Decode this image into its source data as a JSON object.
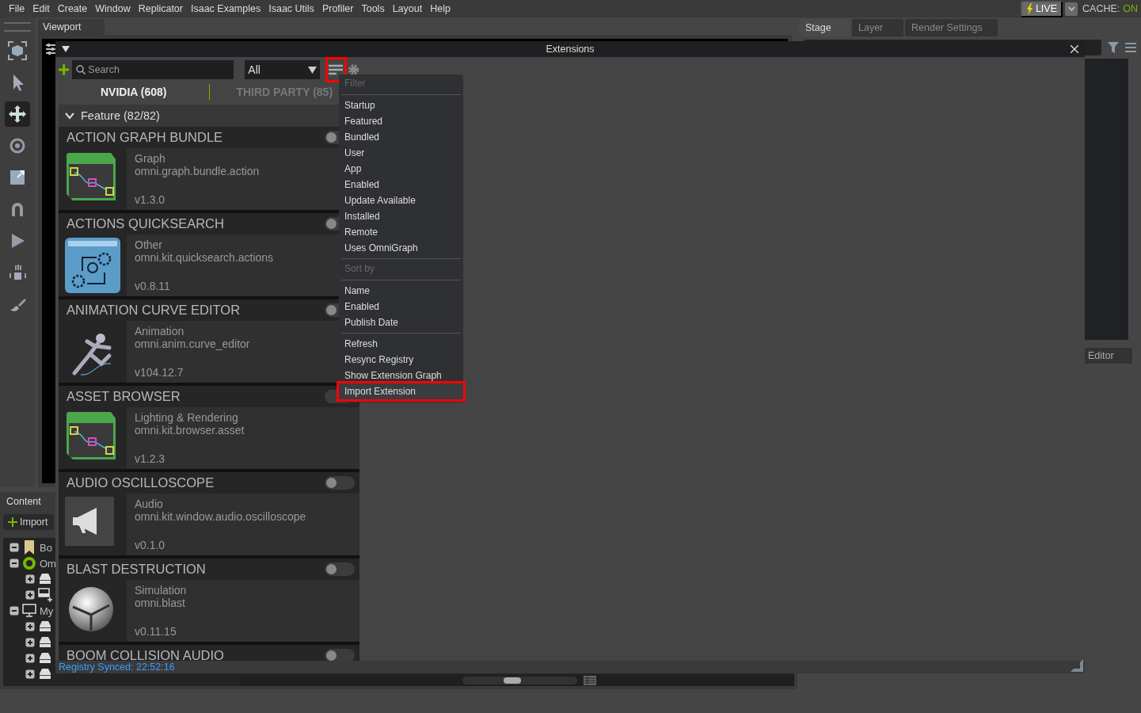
{
  "menu_bar": {
    "items": [
      "File",
      "Edit",
      "Create",
      "Window",
      "Replicator",
      "Isaac Examples",
      "Isaac Utils",
      "Profiler",
      "Tools",
      "Layout",
      "Help"
    ]
  },
  "live": {
    "label": "LIVE",
    "on": true
  },
  "cache": {
    "label": "CACHE:",
    "value": "ON",
    "on": true
  },
  "viewport": {
    "tab": "Viewport"
  },
  "toolbar": [
    {
      "kind": "select",
      "selected": false
    },
    {
      "kind": "pointer",
      "selected": false
    },
    {
      "kind": "move",
      "selected": true
    },
    {
      "kind": "rotate",
      "selected": false
    },
    {
      "kind": "scale",
      "selected": false
    },
    {
      "kind": "snap",
      "selected": false
    },
    {
      "kind": "play",
      "selected": false
    },
    {
      "kind": "drop",
      "selected": false
    },
    {
      "kind": "paint",
      "selected": false
    }
  ],
  "content": {
    "tab": "Content",
    "import_button": "Import",
    "tree": [
      {
        "label": "Bo",
        "kind": "bookmark",
        "expanded": true
      },
      {
        "label": "Om",
        "kind": "omniverse",
        "expanded": true,
        "children": [
          {
            "kind": "drive",
            "expanded": false
          },
          {
            "kind": "drive-add",
            "expanded": false
          }
        ]
      },
      {
        "label": "My",
        "kind": "computer",
        "expanded": true,
        "children": [
          {
            "kind": "drive",
            "expanded": false
          },
          {
            "kind": "drive",
            "expanded": false
          },
          {
            "kind": "drive",
            "expanded": false
          },
          {
            "kind": "drive",
            "expanded": false
          }
        ]
      }
    ],
    "thumbnail_slider": {
      "level": 0.42
    }
  },
  "stage": {
    "tabs": [
      {
        "label": "Stage",
        "selected": true
      },
      {
        "label": "Layer",
        "selected": false
      },
      {
        "label": "Render Settings",
        "selected": false
      }
    ],
    "lower_tab": "Editor"
  },
  "extensions": {
    "title": "Extensions",
    "search": {
      "placeholder": "Search"
    },
    "scope": {
      "value": "All"
    },
    "menu_button": {
      "annotated": true
    },
    "tabs": [
      {
        "label": "NVIDIA (608)",
        "selected": true
      },
      {
        "label": "THIRD PARTY (85)",
        "selected": false
      }
    ],
    "category": {
      "label": "Feature (82/82)",
      "expanded": true
    },
    "items": [
      {
        "title": "ACTION GRAPH BUNDLE",
        "category": "Graph",
        "id": "omni.graph.bundle.action",
        "version": "v1.3.0",
        "enabled": false,
        "kind": "graph"
      },
      {
        "title": "ACTIONS QUICKSEARCH",
        "category": "Other",
        "id": "omni.kit.quicksearch.actions",
        "version": "v0.8.11",
        "enabled": false,
        "kind": "quicksearch"
      },
      {
        "title": "ANIMATION CURVE EDITOR",
        "category": "Animation",
        "id": "omni.anim.curve_editor",
        "version": "v104.12.7",
        "enabled": false,
        "kind": "runner"
      },
      {
        "title": "ASSET BROWSER",
        "category": "Lighting & Rendering",
        "id": "omni.kit.browser.asset",
        "version": "v1.2.3",
        "enabled": true,
        "kind": "graph"
      },
      {
        "title": "AUDIO OSCILLOSCOPE",
        "category": "Audio",
        "id": "omni.kit.window.audio.oscilloscope",
        "version": "v0.1.0",
        "enabled": false,
        "kind": "megaphone"
      },
      {
        "title": "BLAST DESTRUCTION",
        "category": "Simulation",
        "id": "omni.blast",
        "version": "v0.11.15",
        "enabled": false,
        "kind": "sphere"
      },
      {
        "title": "BOOM COLLISION AUDIO",
        "enabled": false
      }
    ],
    "status": "Registry Synced: 22:52:16"
  },
  "menu": {
    "sections": [
      {
        "header": "Filter",
        "items": [
          {
            "label": "Startup",
            "highlighted": false,
            "annotated": false
          },
          {
            "label": "Featured",
            "highlighted": false,
            "annotated": false
          },
          {
            "label": "Bundled",
            "highlighted": false,
            "annotated": false
          },
          {
            "label": "User",
            "highlighted": false,
            "annotated": false
          },
          {
            "label": "App",
            "highlighted": false,
            "annotated": false
          },
          {
            "label": "Enabled",
            "highlighted": false,
            "annotated": false
          },
          {
            "label": "Update Available",
            "highlighted": false,
            "annotated": false
          },
          {
            "label": "Installed",
            "highlighted": false,
            "annotated": false
          },
          {
            "label": "Remote",
            "highlighted": false,
            "annotated": false
          },
          {
            "label": "Uses OmniGraph",
            "highlighted": false,
            "annotated": false
          }
        ]
      },
      {
        "header": "Sort by",
        "items": [
          {
            "label": "Name",
            "highlighted": false,
            "annotated": false
          },
          {
            "label": "Enabled",
            "highlighted": false,
            "annotated": false
          },
          {
            "label": "Publish Date",
            "highlighted": false,
            "annotated": false
          }
        ]
      },
      {
        "items": [
          {
            "label": "Refresh",
            "highlighted": false,
            "annotated": false
          },
          {
            "label": "Resync Registry",
            "highlighted": false,
            "annotated": false
          },
          {
            "label": "Show Extension Graph",
            "highlighted": false,
            "annotated": false
          },
          {
            "label": "Import Extension",
            "highlighted": true,
            "annotated": true
          }
        ]
      }
    ]
  }
}
